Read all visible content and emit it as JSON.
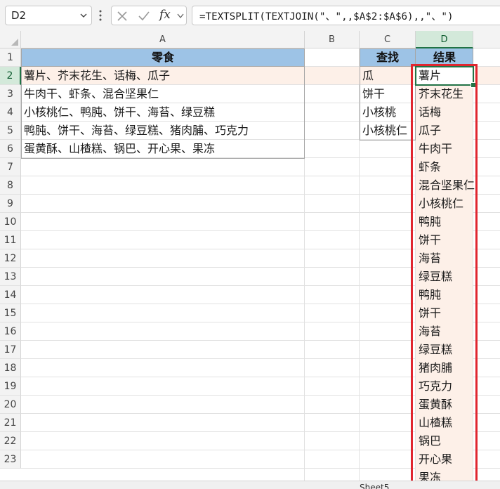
{
  "formula_bar": {
    "name_box": "D2",
    "fx_label": "fx",
    "formula": "=TEXTSPLIT(TEXTJOIN(\"、\",,$A$2:$A$6),,\"、\")"
  },
  "columns": [
    "A",
    "B",
    "C",
    "D"
  ],
  "rows": [
    "1",
    "2",
    "3",
    "4",
    "5",
    "6",
    "7",
    "8",
    "9",
    "10",
    "11",
    "12",
    "13",
    "14",
    "15",
    "16",
    "17",
    "18",
    "19",
    "20",
    "21",
    "22",
    "23"
  ],
  "table_a": {
    "header": "零食",
    "items": [
      "薯片、芥末花生、话梅、瓜子",
      "牛肉干、虾条、混合坚果仁",
      "小核桃仁、鸭肫、饼干、海苔、绿豆糕",
      "鸭肫、饼干、海苔、绿豆糕、猪肉脯、巧克力",
      "蛋黄酥、山楂糕、锅巴、开心果、果冻"
    ]
  },
  "lookup": {
    "header": "查找",
    "items": [
      "瓜",
      "饼干",
      "小核桃",
      "小核桃仁"
    ]
  },
  "result": {
    "header": "结果",
    "items": [
      "薯片",
      "芥末花生",
      "话梅",
      "瓜子",
      "牛肉干",
      "虾条",
      "混合坚果仁",
      "小核桃仁",
      "鸭肫",
      "饼干",
      "海苔",
      "绿豆糕",
      "鸭肫",
      "饼干",
      "海苔",
      "绿豆糕",
      "猪肉脯",
      "巧克力",
      "蛋黄酥",
      "山楂糕",
      "锅巴",
      "开心果",
      "果冻"
    ]
  },
  "sheet_tab": "Sheet5",
  "colors": {
    "header_fill": "#9dc3e6",
    "selection_green": "#217346",
    "highlight_red": "#e0262f",
    "row_highlight": "#fdf0e8"
  }
}
